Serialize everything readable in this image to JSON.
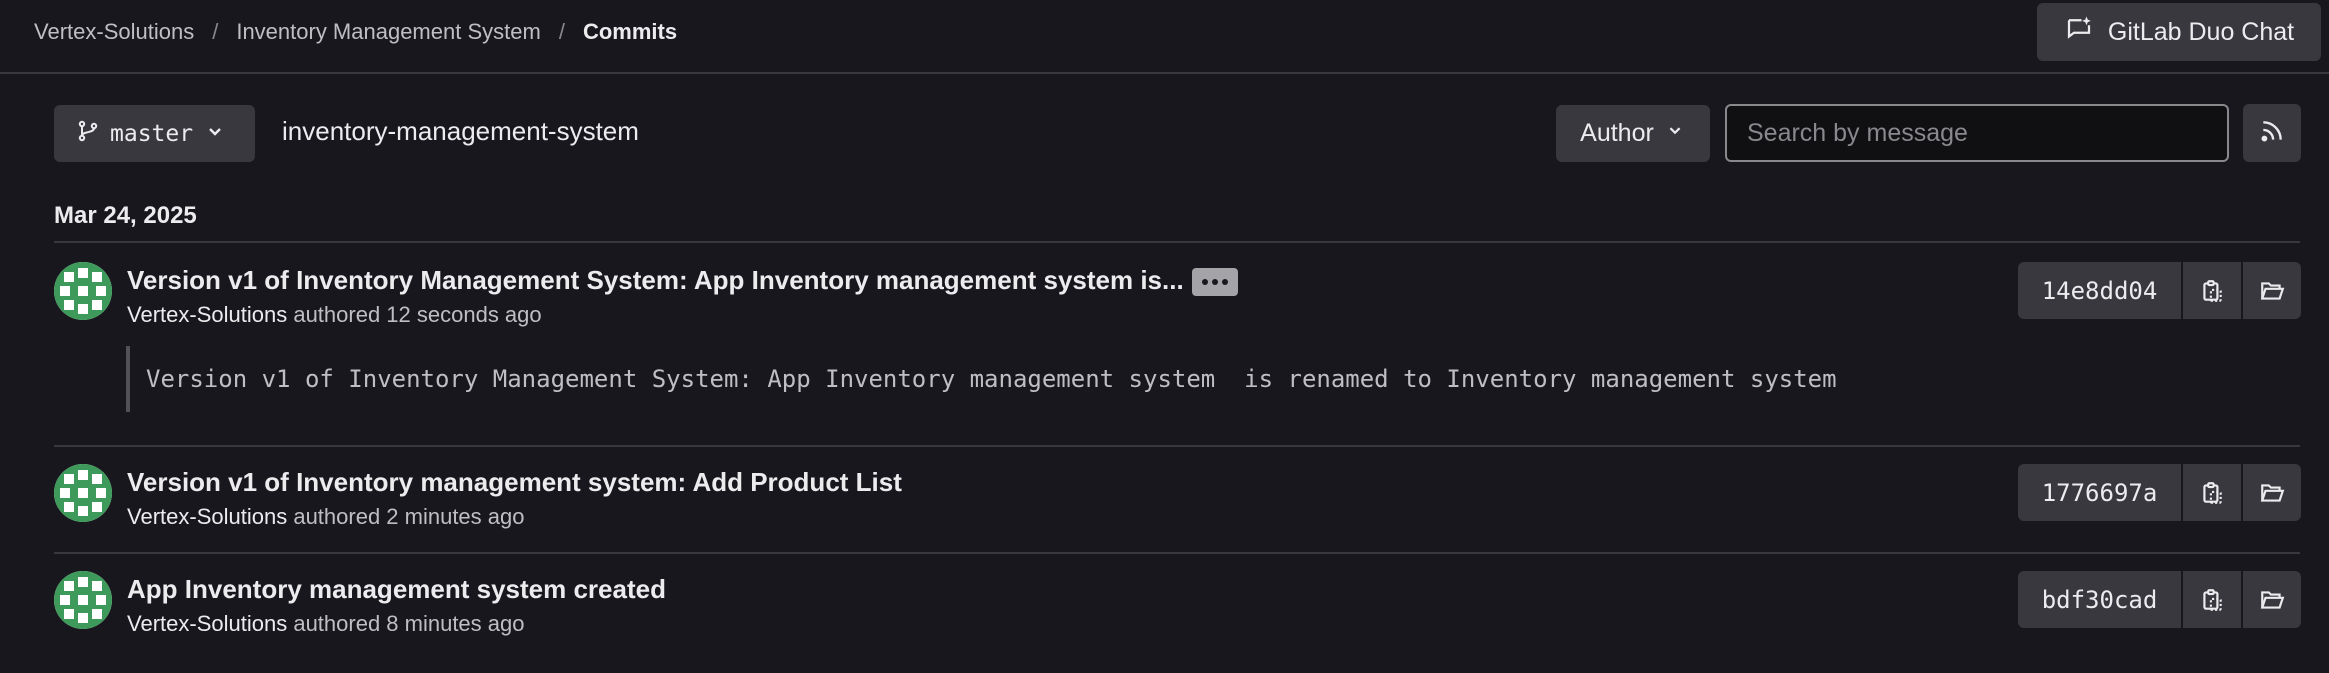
{
  "breadcrumb": {
    "items": [
      "Vertex-Solutions",
      "Inventory Management System",
      "Commits"
    ],
    "separator": "/"
  },
  "header": {
    "duo_chat_label": "GitLab Duo Chat"
  },
  "filters": {
    "branch": "master",
    "project_path": "inventory-management-system",
    "author_label": "Author",
    "search_placeholder": "Search by message"
  },
  "date_heading": "Mar 24, 2025",
  "commits": [
    {
      "title": "Version v1 of Inventory Management System: App Inventory management system is...",
      "author": "Vertex-Solutions",
      "authored_text": "authored 12 seconds ago",
      "description": "Version v1 of Inventory Management System: App Inventory management system  is renamed to Inventory management system",
      "sha": "14e8dd04"
    },
    {
      "title": "Version v1 of Inventory management system: Add Product List",
      "author": "Vertex-Solutions",
      "authored_text": "authored 2 minutes ago",
      "sha": "1776697a"
    },
    {
      "title": "App Inventory management system created",
      "author": "Vertex-Solutions",
      "authored_text": "authored 8 minutes ago",
      "sha": "bdf30cad"
    }
  ],
  "colors": {
    "background": "#18171d",
    "button": "#3a383f",
    "avatar_green": "#3e9a5a"
  }
}
